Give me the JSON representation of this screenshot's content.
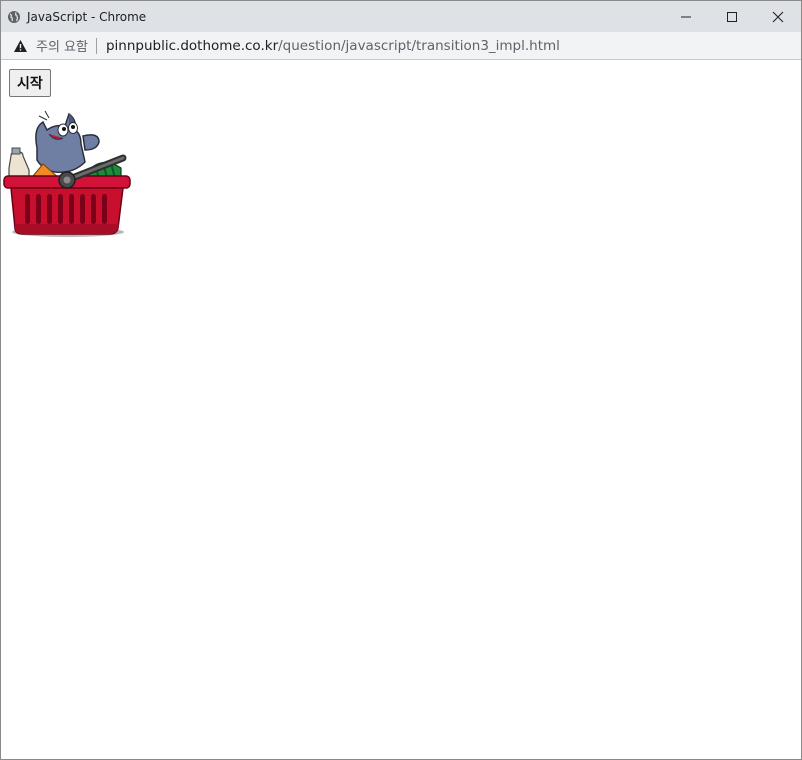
{
  "window": {
    "title": "JavaScript - Chrome",
    "controls": {
      "minimize_icon": "minimize-icon",
      "maximize_icon": "maximize-icon",
      "close_icon": "close-icon"
    }
  },
  "address": {
    "security_label": "주의 요함",
    "url_host": "pinnpublic.dothome.co.kr",
    "url_path": "/question/javascript/transition3_impl.html"
  },
  "page": {
    "start_button_label": "시작",
    "image_icon": "shopping-basket-cat-image"
  },
  "colors": {
    "titlebar_bg": "#dee1e6",
    "addressbar_bg": "#f1f3f4",
    "basket_red": "#c8102e"
  }
}
